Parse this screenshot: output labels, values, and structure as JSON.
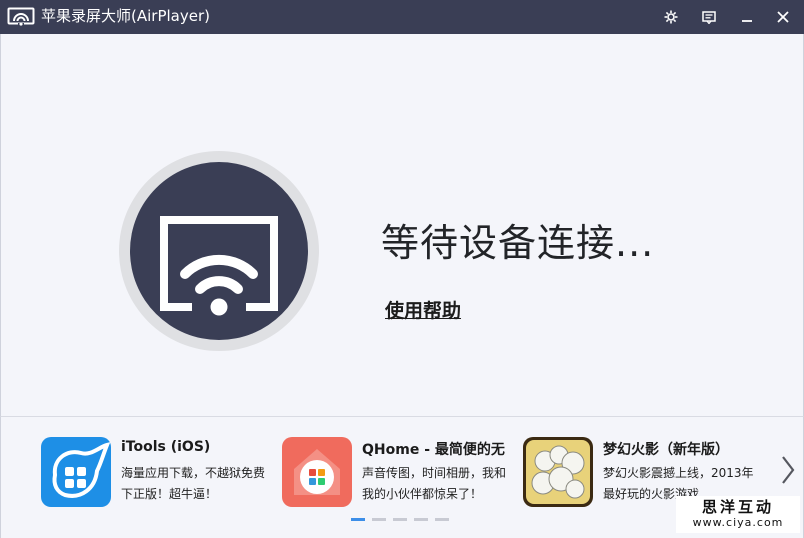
{
  "window": {
    "title": "苹果录屏大师(AirPlayer)",
    "buttons": [
      {
        "name": "settings-button",
        "icon": "gear-icon"
      },
      {
        "name": "feedback-button",
        "icon": "message-icon"
      },
      {
        "name": "minimize-button",
        "icon": "minimize-icon"
      },
      {
        "name": "close-button",
        "icon": "close-icon"
      }
    ]
  },
  "main": {
    "status": "等待设备连接...",
    "help_link": "使用帮助"
  },
  "apps": [
    {
      "name": "iTools (iOS)",
      "desc_line1": "海量应用下载，不越狱免费",
      "desc_line2": "下正版！超牛逼！",
      "icon": "itools-icon"
    },
    {
      "name": "QHome - 最简便的无",
      "desc_line1": "声音传图，时间相册，我和",
      "desc_line2": "我的小伙伴都惊呆了！",
      "icon": "qhome-icon"
    },
    {
      "name": "梦幻火影（新年版）",
      "desc_line1": "梦幻火影震撼上线，2013年",
      "desc_line2": "最好玩的火影游戏",
      "icon": "mengdie-huoying-icon"
    }
  ],
  "pager": {
    "count": 5,
    "active": 0
  },
  "watermark": {
    "line1": "思洋互动",
    "line2": "www.ciya.com"
  },
  "colors": {
    "titlebar": "#3a3e55",
    "accent": "#3c8ee8",
    "disc": "#3a3e55"
  }
}
